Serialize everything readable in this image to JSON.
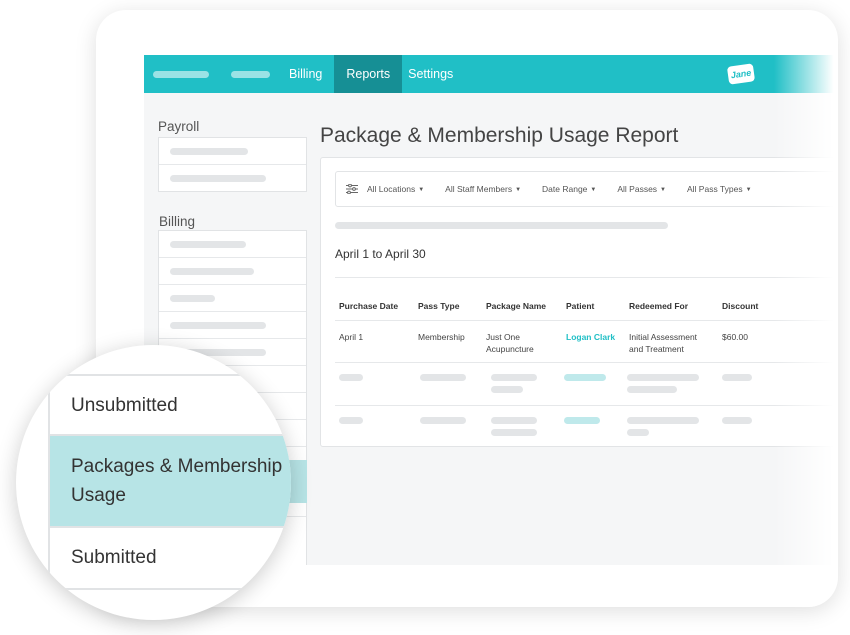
{
  "nav": {
    "links": [
      "Billing",
      "Reports",
      "Settings"
    ],
    "active": "Reports",
    "accent_color": "#20bfc6",
    "active_color": "#168f95",
    "logo_text": "Jane"
  },
  "sidebar": {
    "sections": [
      {
        "heading": "Payroll"
      },
      {
        "heading": "Billing"
      }
    ]
  },
  "report": {
    "title": "Package & Membership Usage Report",
    "filters": [
      "All Locations",
      "All Staff Members",
      "Date Range",
      "All Passes",
      "All Pass Types"
    ],
    "date_range": "April 1 to April 30",
    "columns": [
      "Purchase Date",
      "Pass Type",
      "Package Name",
      "Patient",
      "Redeemed For",
      "Discount"
    ],
    "rows": [
      {
        "purchase_date": "April 1",
        "pass_type": "Membership",
        "package_name": "Just One Acupuncture",
        "patient": "Logan Clark",
        "redeemed_for": "Initial Assessment and Treatment",
        "discount": "$60.00"
      }
    ]
  },
  "magnifier": {
    "items": [
      "Unsubmitted",
      "Packages & Membership Usage",
      "Submitted"
    ],
    "selected": "Packages & Membership Usage",
    "highlight_color": "#b7e4e6"
  }
}
